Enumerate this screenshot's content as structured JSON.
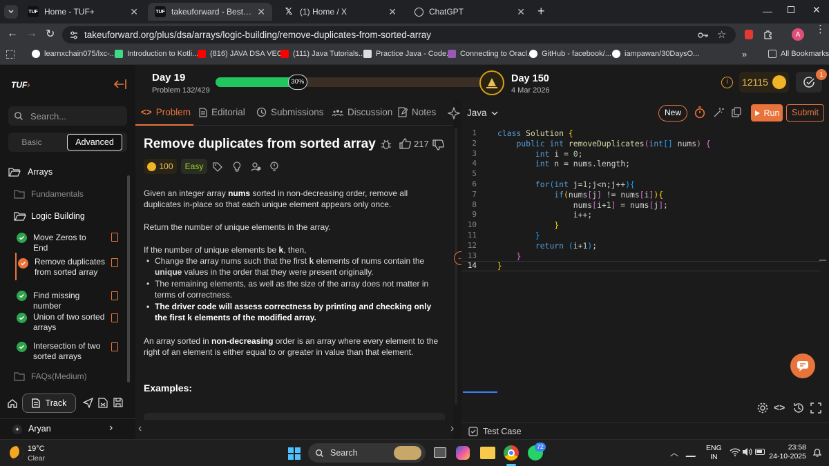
{
  "browser": {
    "tabs": [
      {
        "title": "Home - TUF+",
        "active": false
      },
      {
        "title": "takeuforward - Best Coding Tut",
        "active": true
      },
      {
        "title": "(1) Home / X",
        "active": false
      },
      {
        "title": "ChatGPT",
        "active": false
      }
    ],
    "new_tab": "+",
    "url": "takeuforward.org/plus/dsa/arrays/logic-building/remove-duplicates-from-sorted-array",
    "bookmarks": [
      "learnxchain075/lxc-...",
      "Introduction to Kotli...",
      "(816) JAVA DSA VEC...",
      "(111) Java Tutorials...",
      "Practice Java - Code...",
      "Connecting to Oracl...",
      "GitHub - facebook/...",
      "iampawan/30DaysO...",
      "All Bookmarks"
    ],
    "profile_initial": "A"
  },
  "sidebar": {
    "logo": "TUF",
    "search_placeholder": "Search...",
    "modes": [
      "Basic",
      "Advanced"
    ],
    "section": "Arrays",
    "groups": [
      "Fundamentals",
      "Logic Building"
    ],
    "items": [
      {
        "label": "Move Zeros to End",
        "done": true
      },
      {
        "label": "Remove duplicates from sorted array",
        "done": false,
        "active": true
      },
      {
        "label": "Find missing number",
        "done": true
      },
      {
        "label": "Union of two sorted arrays",
        "done": true
      },
      {
        "label": "Intersection of two sorted arrays",
        "done": true
      }
    ],
    "faq_group": "FAQs(Medium)",
    "track_label": "Track",
    "user": "Aryan"
  },
  "topbar": {
    "day": "Day 19",
    "problem_progress": "Problem 132/429",
    "percent": "30%",
    "percent_value": 30,
    "goal_day": "Day 150",
    "goal_date": "4 Mar 2026",
    "coins": "12115",
    "notifications": "1"
  },
  "problem_tabs": [
    "Problem",
    "Editorial",
    "Submissions",
    "Discussion",
    "Notes"
  ],
  "problem": {
    "title": "Remove duplicates from sorted array",
    "likes": "217",
    "points": "100",
    "difficulty": "Easy",
    "p1_a": "Given an integer array ",
    "p1_b": "nums",
    "p1_c": " sorted in non-decreasing order, remove all duplicates in-place so that each unique element appears only once.",
    "p2": "Return the number of unique elements in the array.",
    "p3_a": "If the number of unique elements be ",
    "p3_b": "k",
    "p3_c": ", then,",
    "b1_a": "Change the array nums such that the first ",
    "b1_b": "k",
    "b1_c": " elements of nums contain the ",
    "b1_d": "unique",
    "b1_e": " values in the order that they were present originally.",
    "b2": "The remaining elements, as well as the size of the array does not matter in terms of correctness.",
    "b3": "The driver code will assess correctness by printing and checking only the first k elements of the modified array.",
    "p4_a": "An array sorted in ",
    "p4_b": "non-decreasing",
    "p4_c": " order is an array where every element to the right of an element is either equal to or greater in value than that element.",
    "examples": "Examples:"
  },
  "editor": {
    "language": "Java",
    "new_label": "New",
    "run_label": "Run",
    "submit_label": "Submit",
    "line_numbers": [
      "1",
      "2",
      "3",
      "4",
      "5",
      "6",
      "7",
      "8",
      "9",
      "10",
      "11",
      "12",
      "13",
      "14"
    ],
    "test_case_label": "Test Case"
  },
  "taskbar": {
    "temp": "19°C",
    "weather": "Clear",
    "search": "Search",
    "whatsapp_badge": "72",
    "lang1": "ENG",
    "lang2": "IN",
    "time": "23:58",
    "date": "24-10-2025"
  },
  "colors": {
    "accent": "#e8743b",
    "progress": "#22c55e",
    "run": "#e8743b"
  }
}
